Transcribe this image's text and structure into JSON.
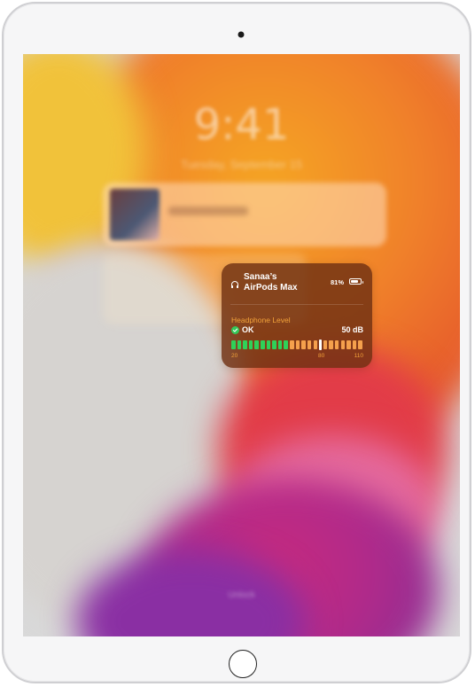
{
  "lock_screen": {
    "time": "9:41",
    "date": "Tuesday, September 15",
    "bottom_hint": "Unlock"
  },
  "now_playing": {
    "title": "Blurred Song Title"
  },
  "headphone_card": {
    "device_name_line1": "Sanaa’s",
    "device_name_line2": "AirPods Max",
    "battery_percent_text": "81%",
    "battery_level": 0.81,
    "section_title": "Headphone Level",
    "status_label": "OK",
    "decibel_value": "50 dB",
    "meter": {
      "total_segments": 22,
      "green_segments": 10,
      "marker_after_segment": 15
    },
    "scale_ticks": [
      {
        "label": "20"
      },
      {
        "label": "80"
      },
      {
        "label": "110"
      }
    ]
  },
  "colors": {
    "accent_orange": "#f2a23a",
    "ok_green": "#34c759",
    "card_bg": "#6e3012"
  },
  "icons": {
    "headphones": "headphones-icon",
    "check": "check-circle-icon",
    "battery": "battery-icon"
  }
}
